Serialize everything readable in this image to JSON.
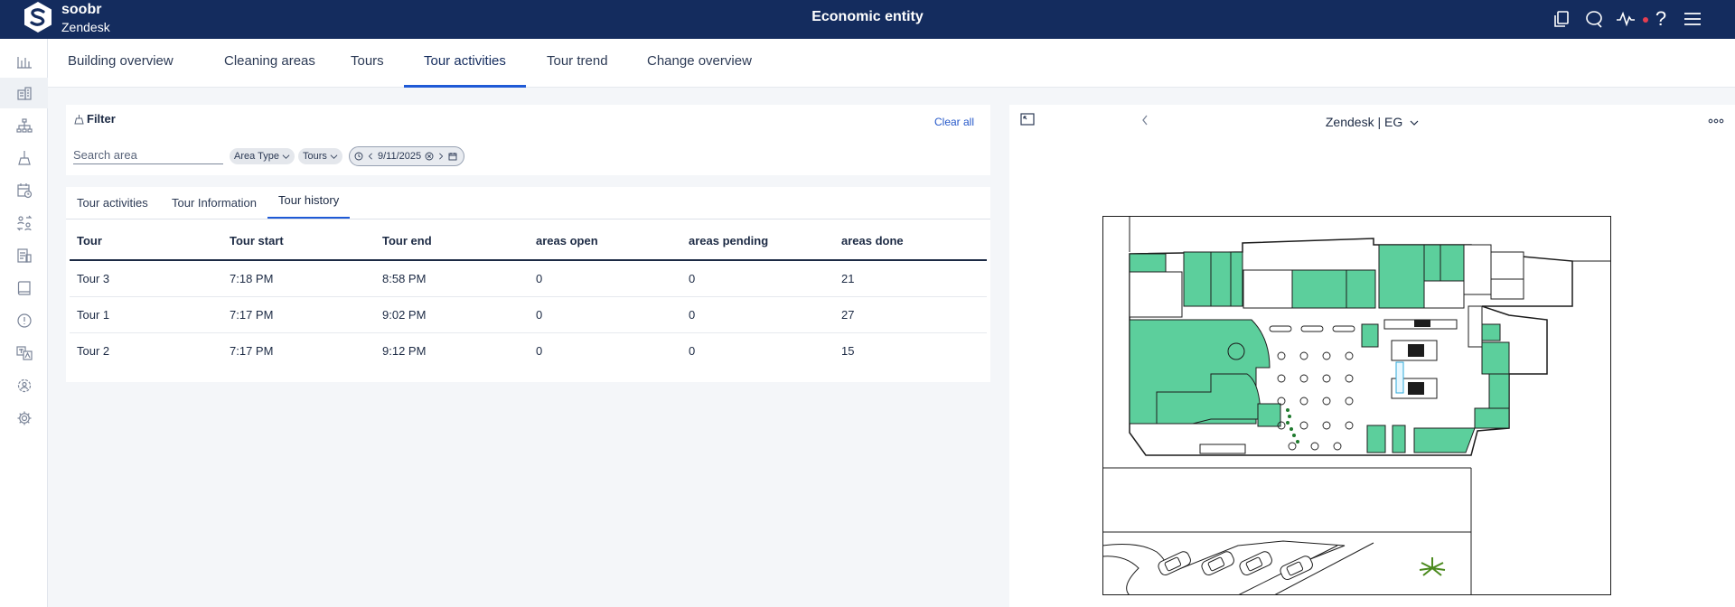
{
  "header": {
    "brand": "soobr",
    "organization": "Zendesk",
    "title": "Economic entity"
  },
  "nav": {
    "tabs": [
      {
        "label": "Building overview"
      },
      {
        "label": "Cleaning areas"
      },
      {
        "label": "Tours"
      },
      {
        "label": "Tour activities"
      },
      {
        "label": "Tour trend"
      },
      {
        "label": "Change overview"
      }
    ],
    "active_tab": "Tour activities"
  },
  "filter": {
    "label": "Filter",
    "clear_all": "Clear all",
    "search_placeholder": "Search area",
    "area_type_chip": "Area Type",
    "tours_chip": "Tours",
    "date": "9/11/2025"
  },
  "subtabs": {
    "items": [
      {
        "label": "Tour activities"
      },
      {
        "label": "Tour Information"
      },
      {
        "label": "Tour history"
      }
    ],
    "active": "Tour history"
  },
  "table": {
    "columns": [
      "Tour",
      "Tour start",
      "Tour end",
      "areas open",
      "areas pending",
      "areas done"
    ],
    "rows": [
      [
        "Tour 3",
        "7:18 PM",
        "8:58 PM",
        "0",
        "0",
        "21"
      ],
      [
        "Tour 1",
        "7:17 PM",
        "9:02 PM",
        "0",
        "0",
        "27"
      ],
      [
        "Tour 2",
        "7:17 PM",
        "9:12 PM",
        "0",
        "0",
        "15"
      ]
    ]
  },
  "map": {
    "location": "Zendesk | EG",
    "area_color": "#5ccf9c"
  },
  "colors": {
    "topbar": "#142c5e",
    "accent": "#1f5ad6",
    "notification": "#e53e50"
  }
}
